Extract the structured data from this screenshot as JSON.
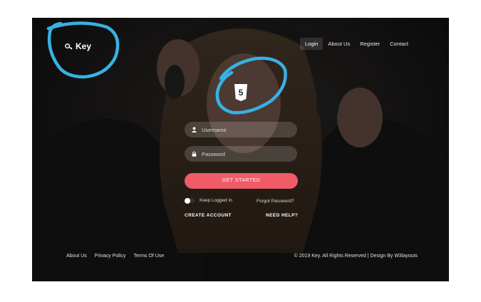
{
  "brand": {
    "name": "Key",
    "icon": "key-icon"
  },
  "nav": {
    "items": [
      "Login",
      "About Us",
      "Register",
      "Contact"
    ],
    "active": "Login"
  },
  "logo": {
    "icon": "html5-icon",
    "text": "5"
  },
  "form": {
    "username_placeholder": "Username",
    "password_placeholder": "Password",
    "submit_label": "GET STARTED",
    "keep_logged_in": "Keep Logged In",
    "forgot_password": "Forgot Password?",
    "create_account": "CREATE ACCOUNT",
    "need_help": "NEED HELP?"
  },
  "footer": {
    "links": [
      "About Us",
      "Privacy Policy",
      "Terms Of Use"
    ],
    "copyright": "© 2019 Key. All Rights Reserved | Design By W3layouts"
  },
  "colors": {
    "accent": "#ef5b66",
    "annotation": "#38b1e3",
    "background": "#1d1d1d"
  }
}
